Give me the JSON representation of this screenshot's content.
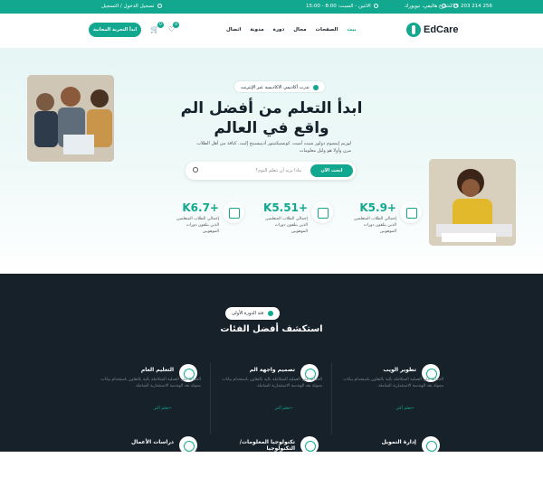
{
  "topbar": {
    "phone": "215 203 214 256",
    "address": "شارع هاليفي، نيويورك",
    "hours": "الاثنين - السبت: 8:00 - 15:00",
    "account": "تسجيل الدخول / التسجيل"
  },
  "header": {
    "logo": "EdCare",
    "nav": [
      "بيت",
      "الصفحات",
      "مجال",
      "دورة",
      "مدونة",
      "اتصال"
    ],
    "cta": "ابدأ التجربة المجانية",
    "wishlist_count": "0",
    "cart_count": "0"
  },
  "hero": {
    "tagline": "تدرب أكاديمي الاكاديمية عبر الإنترنت",
    "title": "ابدأ التعلم من أفضل الم واقع في العالم",
    "subtitle": "لوريم إيبسوم دولور سيت أميت، كونسيكتيتور أديبيسينج إليت. كثافة من أهل الطلاب مرن وأولا هو وليل معلومات",
    "search_placeholder": "ماذا تريد أن تتعلم اليوم؟",
    "search_button": "ابحث الآن",
    "stats": [
      {
        "value": "K5.9+",
        "label": "إجمالي الطلاب المتعلمين الذين يتلقون دورات الموهوبين"
      },
      {
        "value": "K5.51+",
        "label": "إجمالي الطلاب المتعلمين الذين يتلقون دورات الموهوبين"
      },
      {
        "value": "K6.7+",
        "label": "إجمالي الطلاب المتعلمين الذين يتلقون دورات الموهوبين"
      }
    ]
  },
  "categories": {
    "pill": "فئة الدورة الأولى",
    "title": "استكشف أفضل الفئات",
    "link_label": "تعلم أكثر",
    "items": [
      {
        "title": "تطوير الويب",
        "desc": "الحفاظ على العملية المتكاملة بالية بالتعاون باستخدام بيانات ممولة بعد الهندسة الاستثمارية الشاملة."
      },
      {
        "title": "تصميم واجهة الم",
        "desc": "الحفاظ على العملية المتكاملة بالية بالتعاون باستخدام بيانات ممولة بعد الهندسة الاستثمارية الشاملة."
      },
      {
        "title": "التعليم العام",
        "desc": "الحفاظ على العملية المتكاملة بالية بالتعاون باستخدام بيانات ممولة بعد الهندسة الاستثمارية الشاملة."
      },
      {
        "title": "إدارة التمويل",
        "desc": ""
      },
      {
        "title": "تكنولوجيا المعلومات/التكنولوجيا",
        "desc": ""
      },
      {
        "title": "دراسات الأعمال",
        "desc": ""
      }
    ]
  },
  "colors": {
    "accent": "#12a88f",
    "dark": "#16212a"
  }
}
